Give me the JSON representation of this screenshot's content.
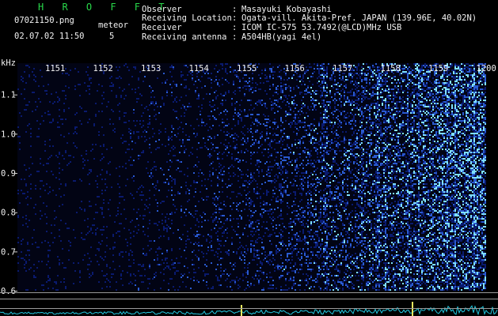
{
  "header": {
    "app_name": "H R O F F T",
    "filename": "07021150.png",
    "datetime": "02.07.02 11:50",
    "meteor_label": "meteor",
    "meteor_count": "5"
  },
  "station": {
    "rows": [
      {
        "label": "Observer",
        "sep": ":",
        "value": "Masayuki Kobayashi"
      },
      {
        "label": "Receiving Location",
        "sep": ":",
        "value": "Ogata-vill. Akita-Pref. JAPAN (139.96E, 40.02N)"
      },
      {
        "label": "Receiver",
        "sep": ":",
        "value": "ICOM IC-575 53.7492(@LCD)MHz USB"
      },
      {
        "label": "Receiving antenna",
        "sep": ":",
        "value": "A504HB(yagi 4el)"
      }
    ]
  },
  "chart_data": {
    "type": "heatmap",
    "ylabel": "kHz",
    "x_ticks": [
      "1151",
      "1152",
      "1153",
      "1154",
      "1155",
      "1156",
      "1157",
      "1158",
      "1159",
      "1200"
    ],
    "y_ticks": [
      "1.1",
      "1.0",
      "0.9",
      "0.8",
      "0.7",
      "0.6"
    ],
    "ylim": [
      0.58,
      1.2
    ]
  },
  "colors": {
    "background": "#000000",
    "signal_low": "#0a1a6e",
    "signal_high": "#7fe0ff",
    "header_green": "#28d84a",
    "baseline": "#9a9a9a",
    "level_trace": "#23c8e0",
    "peak": "#e8e860"
  }
}
